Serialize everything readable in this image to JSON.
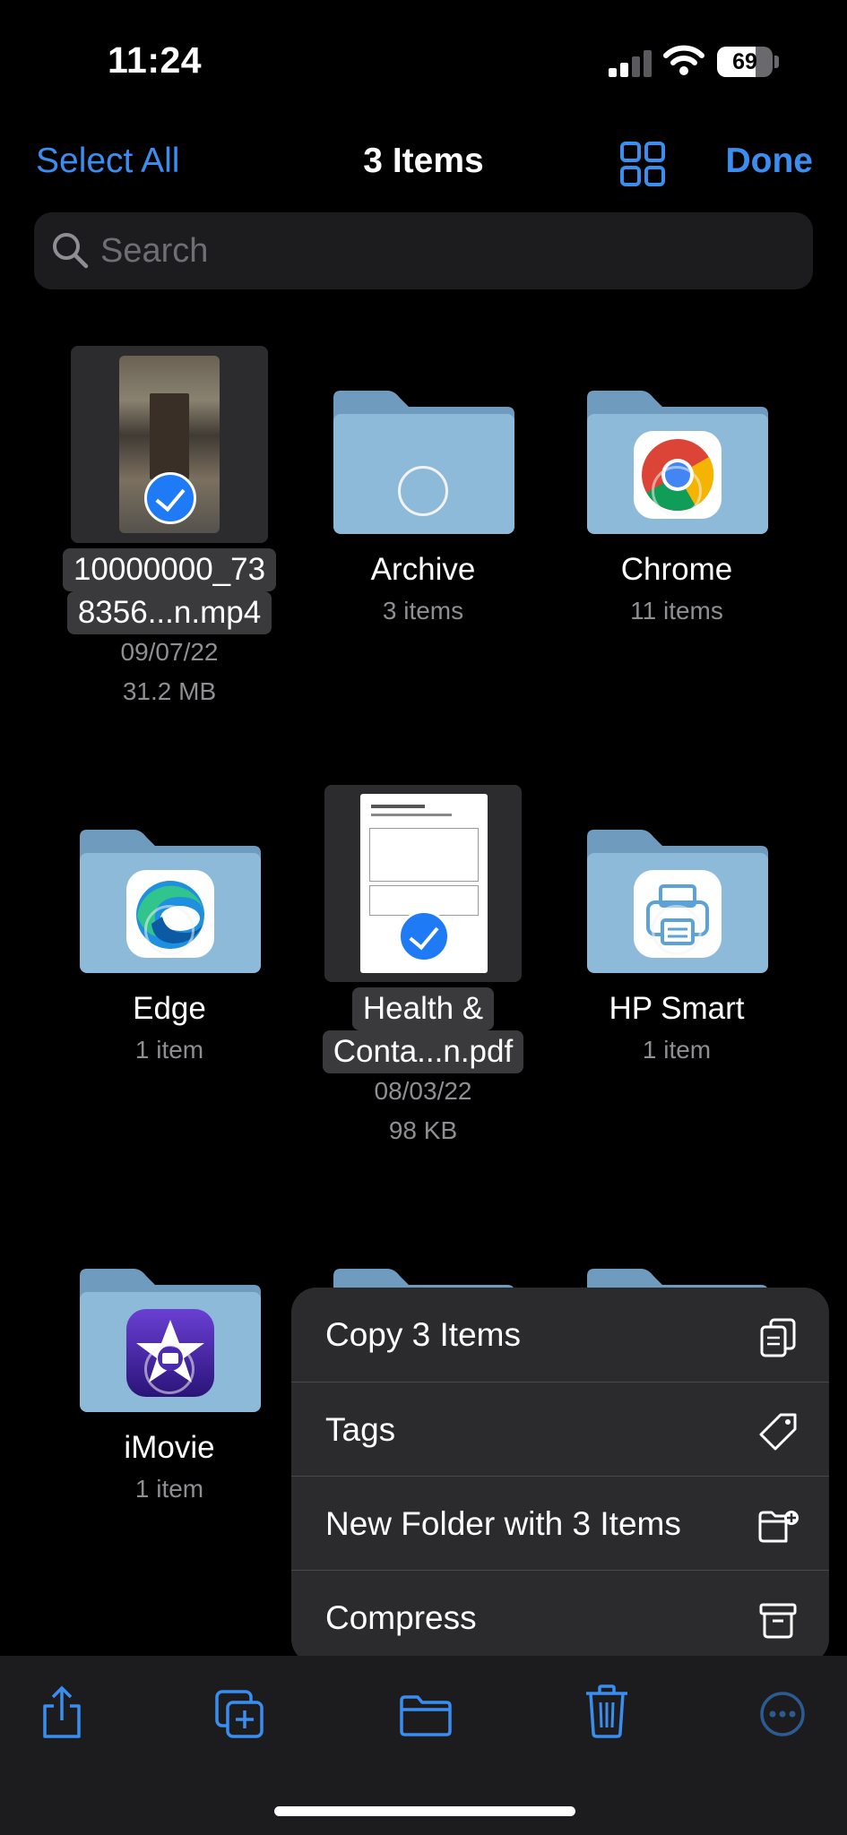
{
  "status": {
    "time": "11:24",
    "battery": "69",
    "battery_level": 0.69
  },
  "nav": {
    "select_all": "Select All",
    "title": "3 Items",
    "done": "Done"
  },
  "search": {
    "placeholder": "Search"
  },
  "items": [
    {
      "name_line1": "10000000_73",
      "name_line2": "8356...n.mp4",
      "date": "09/07/22",
      "size": "31.2 MB",
      "selected": true
    },
    {
      "name": "Archive",
      "count": "3 items",
      "selected": false
    },
    {
      "name": "Chrome",
      "count": "11 items",
      "icon": "chrome-icon"
    },
    {
      "name": "Edge",
      "count": "1 item",
      "icon": "edge-icon"
    },
    {
      "name_line1": "Health &",
      "name_line2": "Conta...n.pdf",
      "date": "08/03/22",
      "size": "98 KB",
      "selected": true
    },
    {
      "name": "HP Smart",
      "count": "1 item",
      "icon": "hp-smart-icon"
    },
    {
      "name": "iMovie",
      "count": "1 item",
      "icon": "imovie-icon"
    }
  ],
  "menu": [
    {
      "label": "Copy 3 Items",
      "icon": "copy-icon"
    },
    {
      "label": "Tags",
      "icon": "tag-icon"
    },
    {
      "label": "New Folder with 3 Items",
      "icon": "new-folder-icon"
    },
    {
      "label": "Compress",
      "icon": "archive-box-icon"
    }
  ],
  "toolbar": [
    "share-icon",
    "duplicate-icon",
    "move-folder-icon",
    "trash-icon",
    "more-icon"
  ],
  "colors": {
    "accent": "#3a8ef0",
    "folder": "#8dbad9",
    "checkmark": "#1f7af5"
  }
}
